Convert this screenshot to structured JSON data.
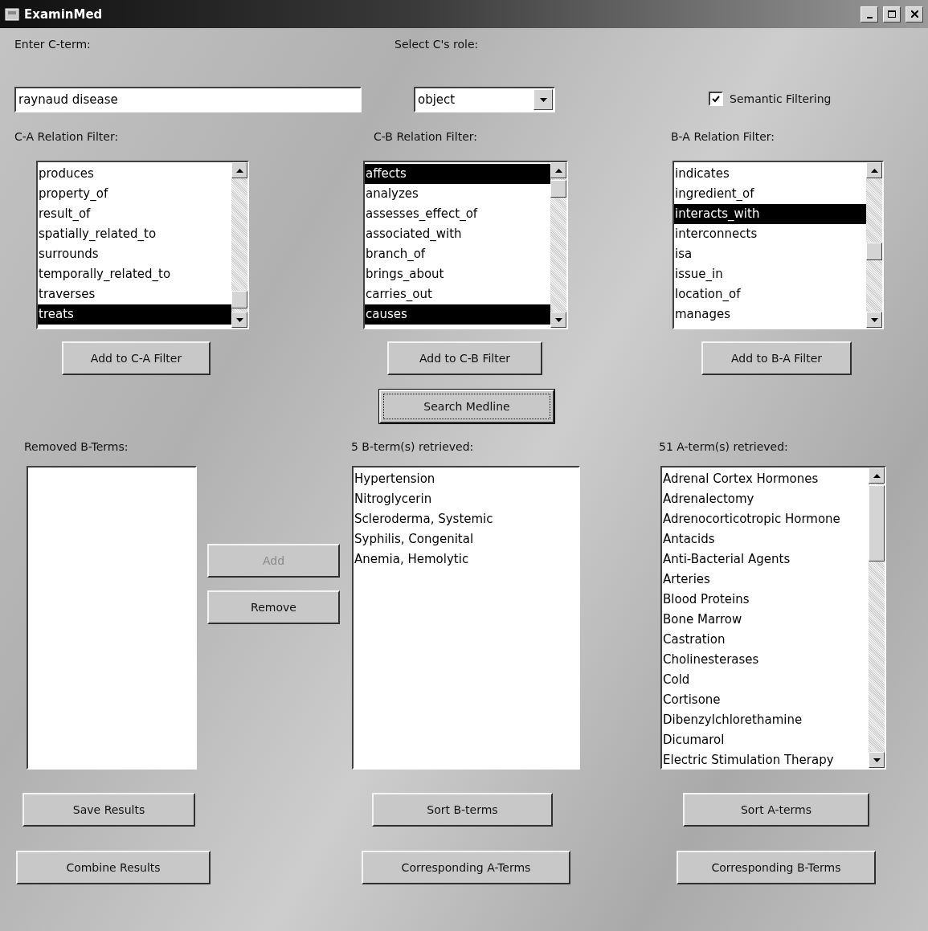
{
  "window": {
    "title": "ExaminMed"
  },
  "c_term": {
    "label": "Enter C-term:",
    "value": "raynaud disease"
  },
  "role": {
    "label": "Select C's role:",
    "value": "object"
  },
  "semantic_filtering": {
    "label": "Semantic Filtering",
    "checked": true
  },
  "relation_filters": [
    {
      "label": "C-A Relation Filter:",
      "button": "Add to C-A Filter",
      "items": [
        {
          "text": "produces",
          "selected": false
        },
        {
          "text": "property_of",
          "selected": false
        },
        {
          "text": "result_of",
          "selected": false
        },
        {
          "text": "spatially_related_to",
          "selected": false
        },
        {
          "text": "surrounds",
          "selected": false
        },
        {
          "text": "temporally_related_to",
          "selected": false
        },
        {
          "text": "traverses",
          "selected": false
        },
        {
          "text": "treats",
          "selected": true
        }
      ]
    },
    {
      "label": "C-B Relation Filter:",
      "button": "Add to C-B Filter",
      "items": [
        {
          "text": "affects",
          "selected": true
        },
        {
          "text": "analyzes",
          "selected": false
        },
        {
          "text": "assesses_effect_of",
          "selected": false
        },
        {
          "text": "associated_with",
          "selected": false
        },
        {
          "text": "branch_of",
          "selected": false
        },
        {
          "text": "brings_about",
          "selected": false
        },
        {
          "text": "carries_out",
          "selected": false
        },
        {
          "text": "causes",
          "selected": true
        }
      ]
    },
    {
      "label": "B-A Relation Filter:",
      "button": "Add to B-A Filter",
      "items": [
        {
          "text": "indicates",
          "selected": false
        },
        {
          "text": "ingredient_of",
          "selected": false
        },
        {
          "text": "interacts_with",
          "selected": true
        },
        {
          "text": "interconnects",
          "selected": false
        },
        {
          "text": "isa",
          "selected": false
        },
        {
          "text": "issue_in",
          "selected": false
        },
        {
          "text": "location_of",
          "selected": false
        },
        {
          "text": "manages",
          "selected": false
        }
      ]
    }
  ],
  "search_button": {
    "label": "Search Medline",
    "focused": true
  },
  "removed_b_terms": {
    "label": "Removed B-Terms:"
  },
  "add_remove": [
    {
      "label": "Add",
      "disabled": true
    },
    {
      "label": "Remove",
      "disabled": false
    }
  ],
  "b_terms": {
    "label": "5 B-term(s) retrieved:",
    "items": [
      "Hypertension",
      "Nitroglycerin",
      "Scleroderma, Systemic",
      "Syphilis, Congenital",
      "Anemia, Hemolytic"
    ],
    "buttons": [
      "Sort B-terms",
      "Corresponding A-Terms"
    ]
  },
  "a_terms": {
    "label": "51 A-term(s) retrieved:",
    "items": [
      "Adrenal Cortex Hormones",
      "Adrenalectomy",
      "Adrenocorticotropic Hormone",
      "Antacids",
      "Anti-Bacterial Agents",
      "Arteries",
      "Blood Proteins",
      "Bone Marrow",
      "Castration",
      "Cholinesterases",
      "Cold",
      "Cortisone",
      "Dibenzylchlorethamine",
      "Dicumarol",
      "Electric Stimulation Therapy"
    ],
    "buttons": [
      "Sort A-terms",
      "Corresponding B-Terms"
    ]
  },
  "left_buttons": [
    "Save Results",
    "Combine Results"
  ]
}
